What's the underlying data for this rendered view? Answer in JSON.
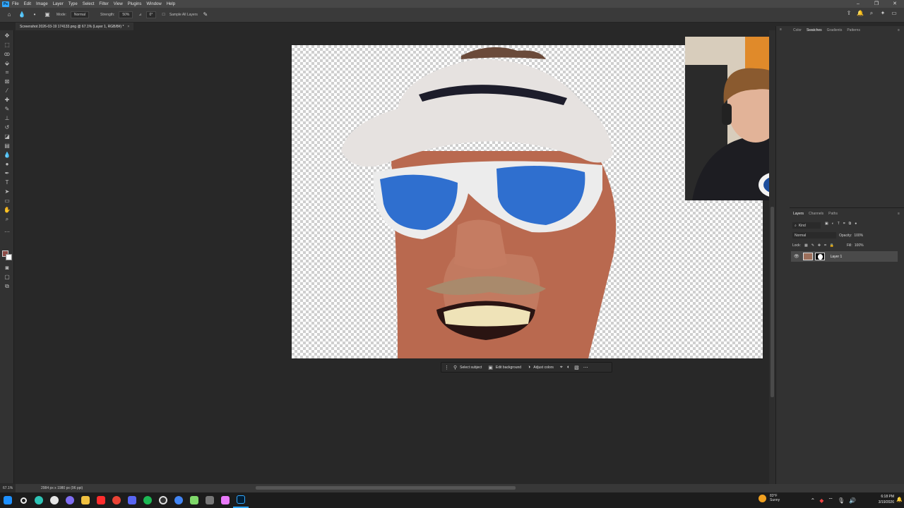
{
  "app": {
    "logo": "Ps"
  },
  "menubar": {
    "items": [
      "File",
      "Edit",
      "Image",
      "Layer",
      "Type",
      "Select",
      "Filter",
      "View",
      "Plugins",
      "Window",
      "Help"
    ]
  },
  "window_controls": [
    "–",
    "❐",
    "✕"
  ],
  "options": {
    "mode_label": "Mode:",
    "mode_value": "Normal",
    "strength_label": "Strength:",
    "strength_value": "50%",
    "angle_value": "0°",
    "sample_all_layers": "Sample All Layers"
  },
  "document": {
    "tab_title": "Screenshot 2026-03-19 174133.png @ 67.1% (Layer 1, RGB/8#) *",
    "close": "×"
  },
  "context_bar": {
    "select_subject": "Select subject",
    "edit_background": "Edit background",
    "adjust_colors": "Adjust colors"
  },
  "top_panel": {
    "tabs": [
      "Color",
      "Swatches",
      "Gradients",
      "Patterns"
    ],
    "active": "Swatches"
  },
  "layers_panel": {
    "tabs": [
      "Layers",
      "Channels",
      "Paths"
    ],
    "active": "Layers",
    "filter": "Kind",
    "blend_mode": "Normal",
    "opacity_label": "Opacity:",
    "opacity_value": "100%",
    "lock_label": "Lock:",
    "fill_label": "Fill:",
    "fill_value": "100%",
    "layers": [
      {
        "name": "Layer 1",
        "visible": true
      }
    ]
  },
  "status": {
    "zoom": "67.1%",
    "dimensions": "2984 px x 1980 px (96 ppi)"
  },
  "taskbar": {
    "icon_colors": [
      "#1e90ff",
      "#ffffff",
      "#2ec4b6",
      "#e5e5e5",
      "#7f6df2",
      "#f0c040",
      "#ff2d2d",
      "#ea4335",
      "#5865f2",
      "#1db954",
      "#c22",
      "#4285f4",
      "#7fd86a",
      "#666",
      "#e879f9",
      "#31a8ff"
    ]
  },
  "weather": {
    "temp": "83°F",
    "condition": "Sunny"
  },
  "clock": {
    "time": "6:18 PM",
    "date": "3/19/2026"
  }
}
